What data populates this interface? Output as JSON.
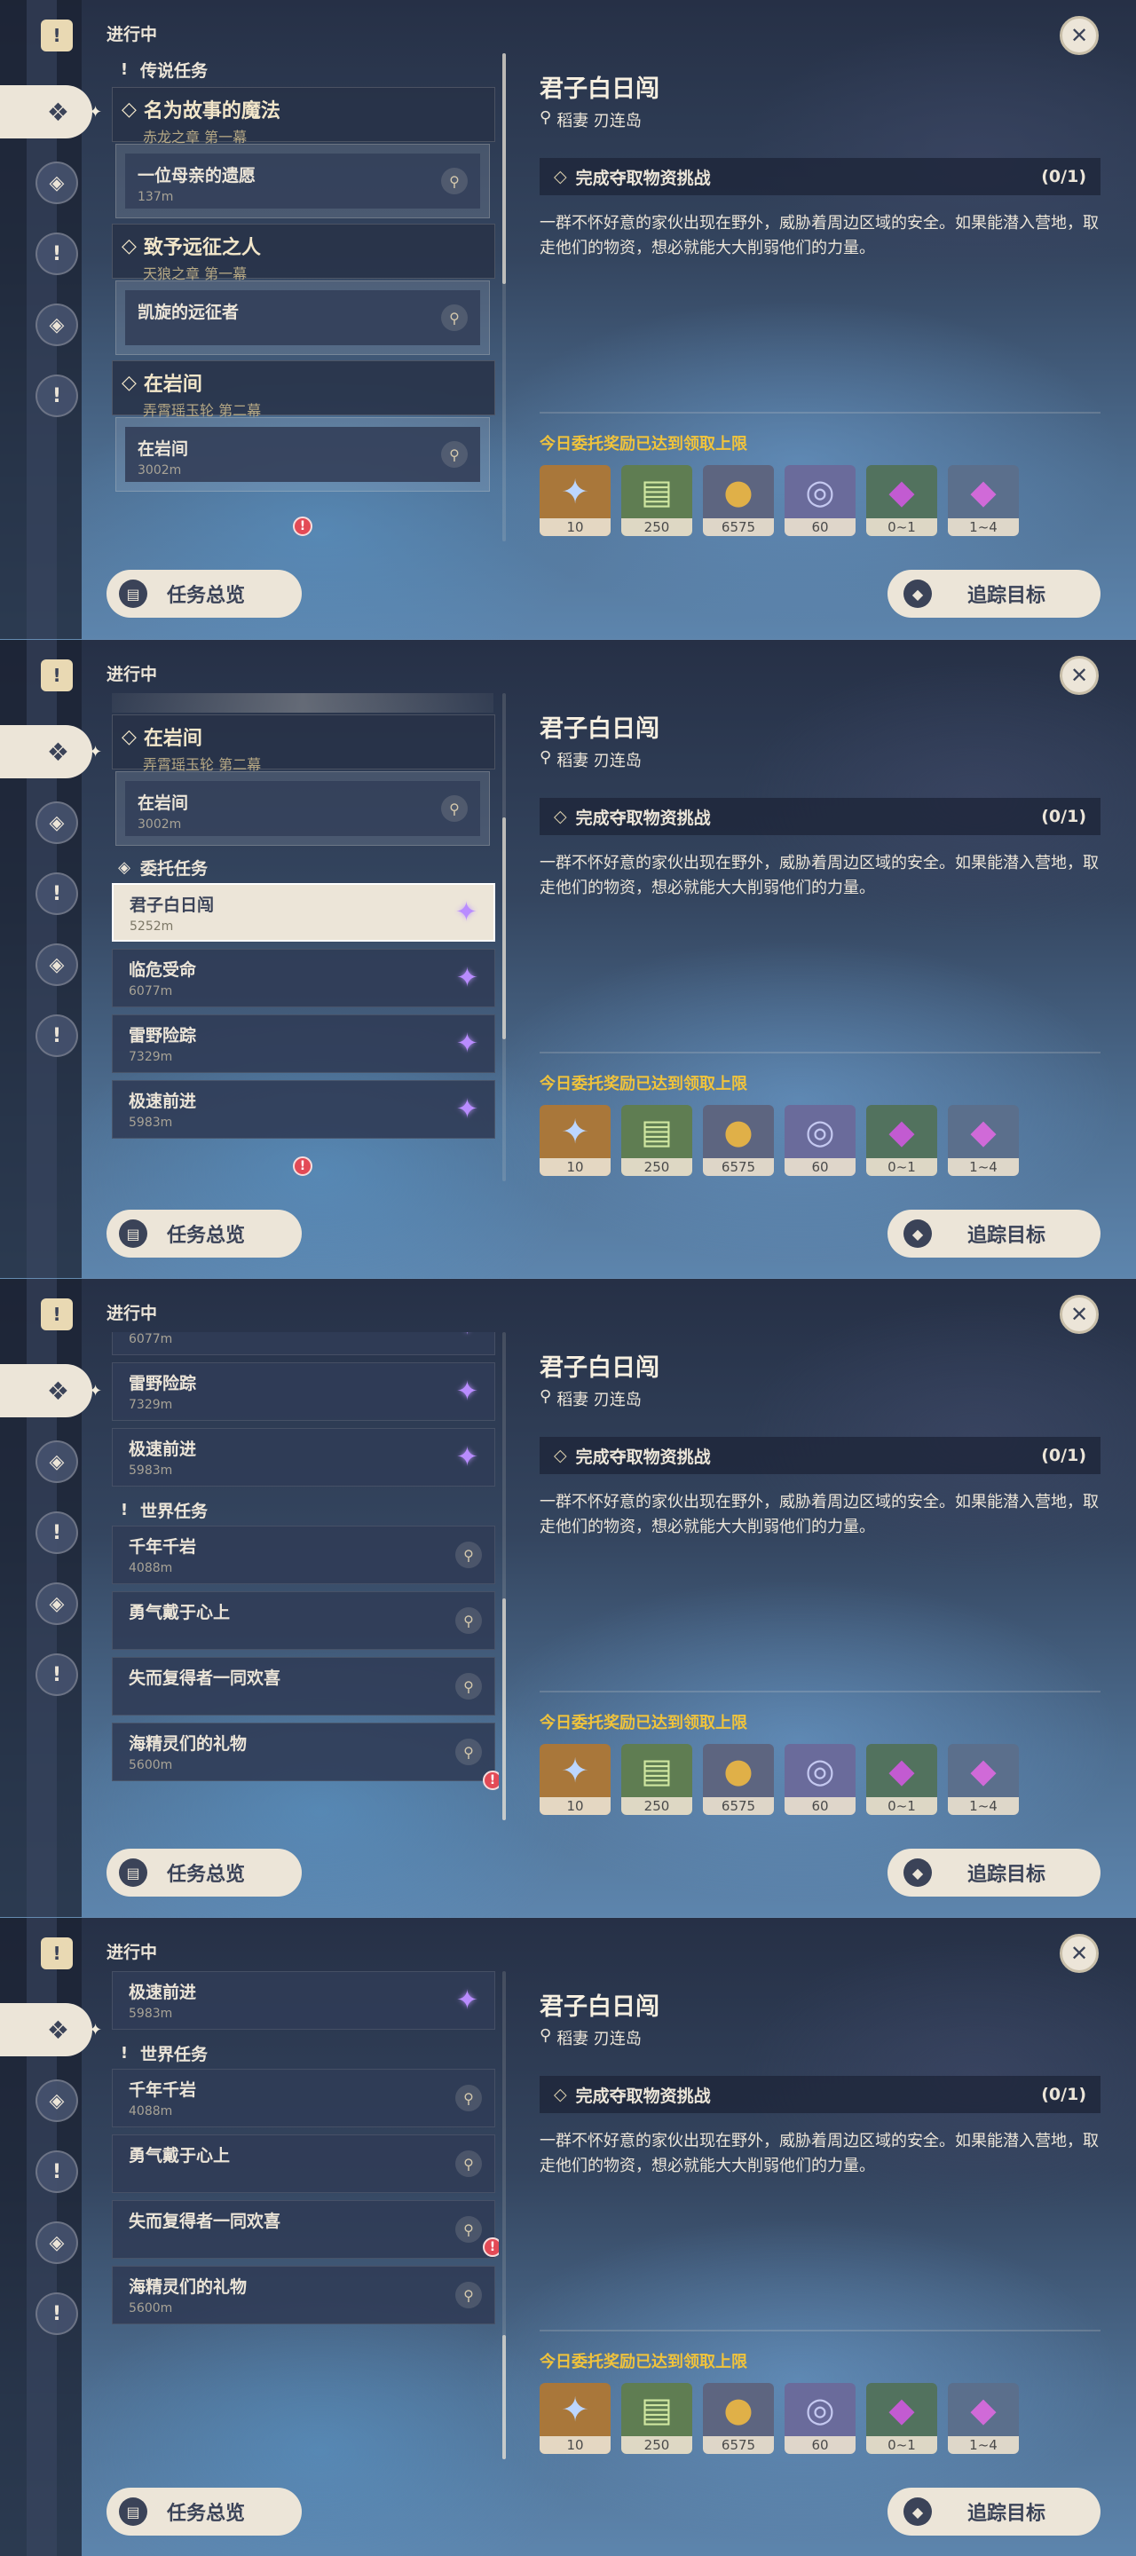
{
  "status_label": "进行中",
  "sections": {
    "legend": "传说任务",
    "commission": "委托任务",
    "world": "世界任务"
  },
  "legend_quests": [
    {
      "title": "名为故事的魔法",
      "chapter": "赤龙之章 第一幕",
      "step": "一位母亲的遗愿",
      "distance": "137m"
    },
    {
      "title": "致予远征之人",
      "chapter": "天狼之章 第一幕",
      "step": "凯旋的远征者",
      "distance": ""
    },
    {
      "title": "在岩间",
      "chapter": "弄霄瑶玉轮 第二幕",
      "step": "在岩间",
      "distance": "3002m"
    }
  ],
  "commissions": [
    {
      "title": "君子白日闯",
      "distance": "5252m"
    },
    {
      "title": "临危受命",
      "distance": "6077m"
    },
    {
      "title": "雷野险踪",
      "distance": "7329m"
    },
    {
      "title": "极速前进",
      "distance": "5983m"
    }
  ],
  "world_quests": [
    {
      "title": "千年千岩",
      "distance": "4088m"
    },
    {
      "title": "勇气戴于心上",
      "distance": ""
    },
    {
      "title": "失而复得者一同欢喜",
      "distance": ""
    },
    {
      "title": "海精灵们的礼物",
      "distance": "5600m"
    }
  ],
  "detail": {
    "title": "君子白日闯",
    "location": "稻妻 刃连岛",
    "objective": "完成夺取物资挑战",
    "objective_progress": "(0/1)",
    "description": "一群不怀好意的家伙出现在野外，威胁着周边区域的安全。如果能潜入营地，取走他们的物资，想必就能大大削弱他们的力量。",
    "reward_note": "今日委托奖励已达到领取上限",
    "rewards": [
      {
        "icon": "primogem-icon",
        "count": "10",
        "color": "#a9773a"
      },
      {
        "icon": "adventure-exp-icon",
        "count": "250",
        "color": "#5f7d52"
      },
      {
        "icon": "mora-icon",
        "count": "6575",
        "color": "#5d6580"
      },
      {
        "icon": "friendship-exp-icon",
        "count": "60",
        "color": "#6a6b9b"
      },
      {
        "icon": "crystal-chunk-icon",
        "count": "0~1",
        "color": "#52725e"
      },
      {
        "icon": "crystal-cluster-icon",
        "count": "1~4",
        "color": "#5b6f8c"
      }
    ]
  },
  "buttons": {
    "overview": "任务总览",
    "track": "追踪目标"
  },
  "icons": {
    "close": "close-icon",
    "pin": "map-pin-icon",
    "commission": "commission-star-icon"
  }
}
